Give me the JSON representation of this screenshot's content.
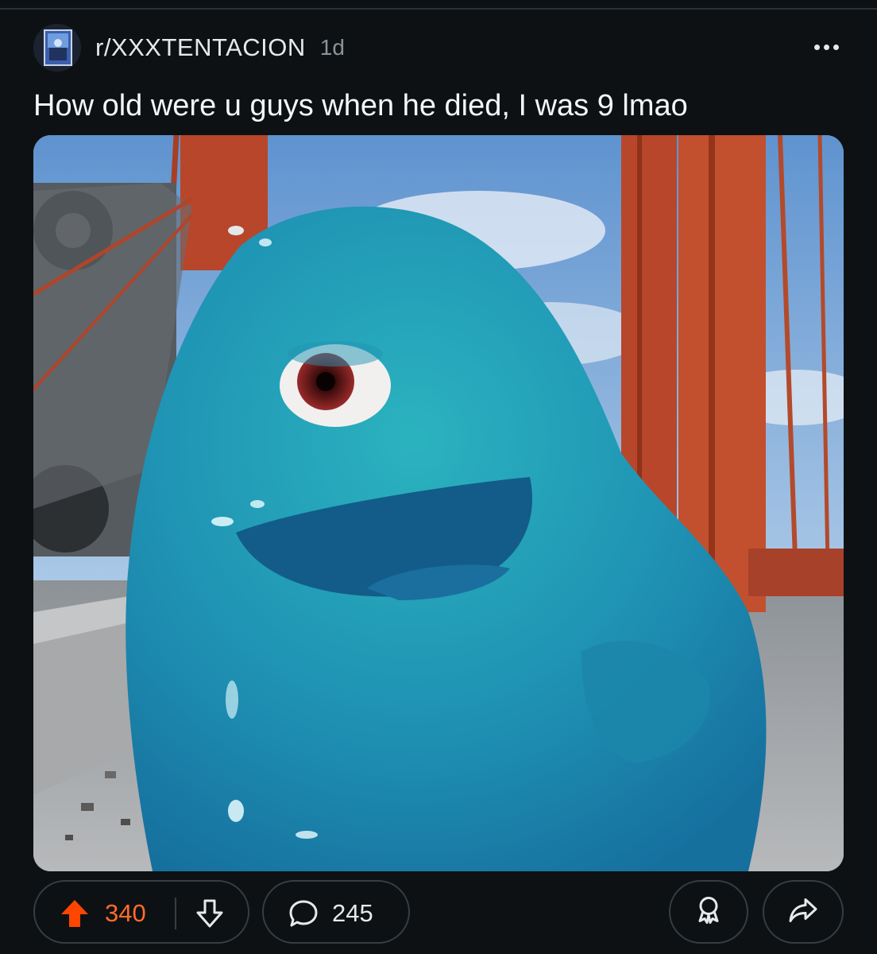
{
  "post": {
    "subreddit": "r/XXXTENTACION",
    "age": "1d",
    "title": "How old were u guys when he died, I was 9 lmao"
  },
  "actions": {
    "score": "340",
    "comments": "245"
  },
  "icons": {
    "more": "more-options-icon",
    "upvote": "upvote-arrow-icon",
    "downvote": "downvote-arrow-icon",
    "comment": "comment-bubble-icon",
    "award": "award-icon",
    "share": "share-arrow-icon"
  },
  "colors": {
    "background": "#0e1113",
    "upvote_active": "#ff4500",
    "score_text": "#ff6b2c",
    "pill_border": "#343e44"
  }
}
